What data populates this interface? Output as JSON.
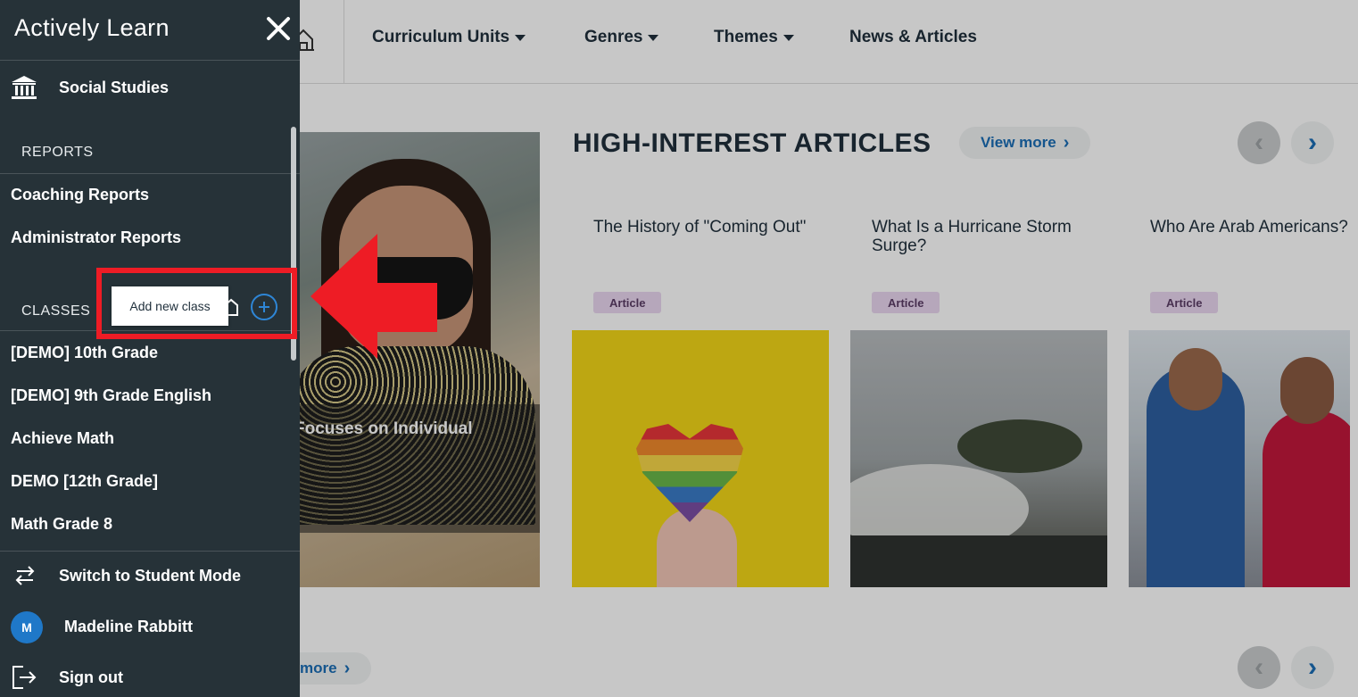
{
  "topnav": {
    "items": [
      {
        "label": "Curriculum Units",
        "dropdown": true
      },
      {
        "label": "Genres",
        "dropdown": true
      },
      {
        "label": "Themes",
        "dropdown": true
      },
      {
        "label": "News & Articles",
        "dropdown": false
      }
    ]
  },
  "hero": {
    "caption": "Focuses on Individual"
  },
  "section": {
    "title": "HIGH-INTEREST ARTICLES",
    "view_more": "View more",
    "view_more_bottom": "more"
  },
  "cards": [
    {
      "title": "The History of \"Coming Out\"",
      "badge": "Article",
      "image": "rainbow-heart"
    },
    {
      "title": "What Is a Hurricane Storm Surge?",
      "badge": "Article",
      "image": "storm-surge"
    },
    {
      "title": "Who Are Arab Americans?",
      "badge": "Article",
      "image": "friends-sitting"
    }
  ],
  "drawer": {
    "logo": "Actively Learn",
    "subject": "Social Studies",
    "reports_heading": "REPORTS",
    "reports": [
      "Coaching Reports",
      "Administrator Reports"
    ],
    "classes_heading": "CLASSES",
    "tooltip": "Add new class",
    "classes": [
      "[DEMO] 10th Grade",
      "[DEMO] 9th Grade English",
      "Achieve Math",
      "DEMO [12th Grade]",
      "Math Grade 8"
    ],
    "switch_mode": "Switch to Student Mode",
    "user": {
      "name": "Madeline Rabbitt",
      "initial": "M"
    },
    "sign_out": "Sign out"
  },
  "colors": {
    "drawer_bg": "#263238",
    "accent_blue": "#1a6db5",
    "highlight_red": "#ee1c25",
    "badge_bg": "#ead7f0"
  }
}
